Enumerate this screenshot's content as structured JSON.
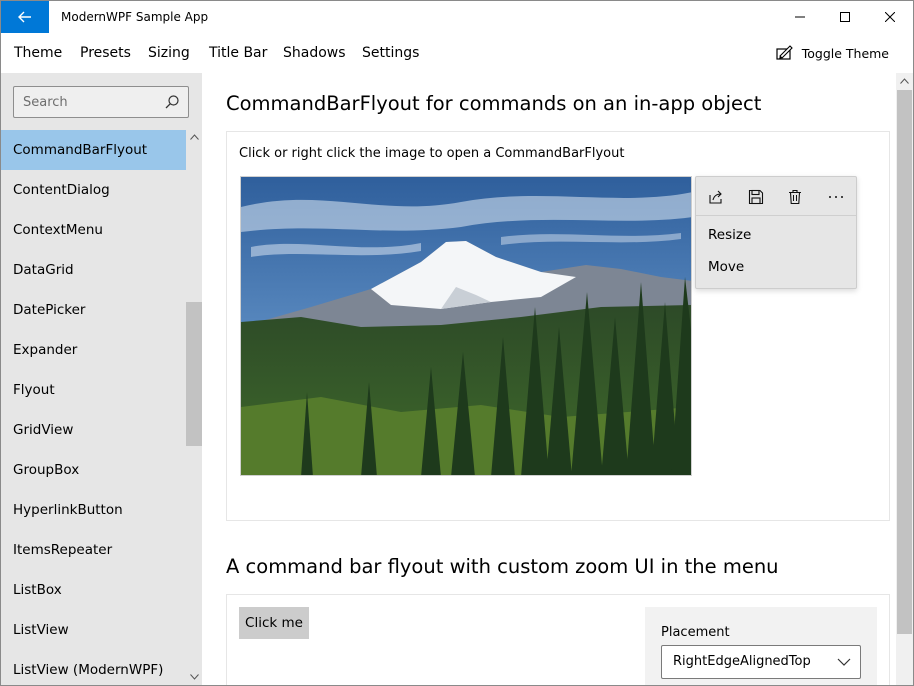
{
  "window": {
    "title": "ModernWPF Sample App"
  },
  "menu": {
    "items": [
      "Theme",
      "Presets",
      "Sizing",
      "Title Bar",
      "Shadows",
      "Settings"
    ],
    "toggle_theme": "Toggle Theme"
  },
  "sidebar": {
    "search_placeholder": "Search",
    "items": [
      {
        "label": "CommandBarFlyout",
        "selected": true
      },
      {
        "label": "ContentDialog"
      },
      {
        "label": "ContextMenu"
      },
      {
        "label": "DataGrid"
      },
      {
        "label": "DatePicker"
      },
      {
        "label": "Expander"
      },
      {
        "label": "Flyout"
      },
      {
        "label": "GridView"
      },
      {
        "label": "GroupBox"
      },
      {
        "label": "HyperlinkButton"
      },
      {
        "label": "ItemsRepeater"
      },
      {
        "label": "ListBox"
      },
      {
        "label": "ListView"
      },
      {
        "label": "ListView (ModernWPF)"
      }
    ]
  },
  "section1": {
    "title": "CommandBarFlyout for commands on an in-app object",
    "caption": "Click or right click the image to open a CommandBarFlyout",
    "flyout": {
      "commands": [
        "share-icon",
        "save-icon",
        "delete-icon",
        "more-icon"
      ],
      "items": [
        "Resize",
        "Move"
      ]
    }
  },
  "section2": {
    "title": "A command bar flyout with custom zoom UI in the menu",
    "button_label": "Click me",
    "placement_label": "Placement",
    "placement_value": "RightEdgeAlignedTop"
  },
  "colors": {
    "accent": "#0078d7",
    "selected_item": "#99c6ea",
    "sidebar_bg": "#e6e6e6"
  }
}
